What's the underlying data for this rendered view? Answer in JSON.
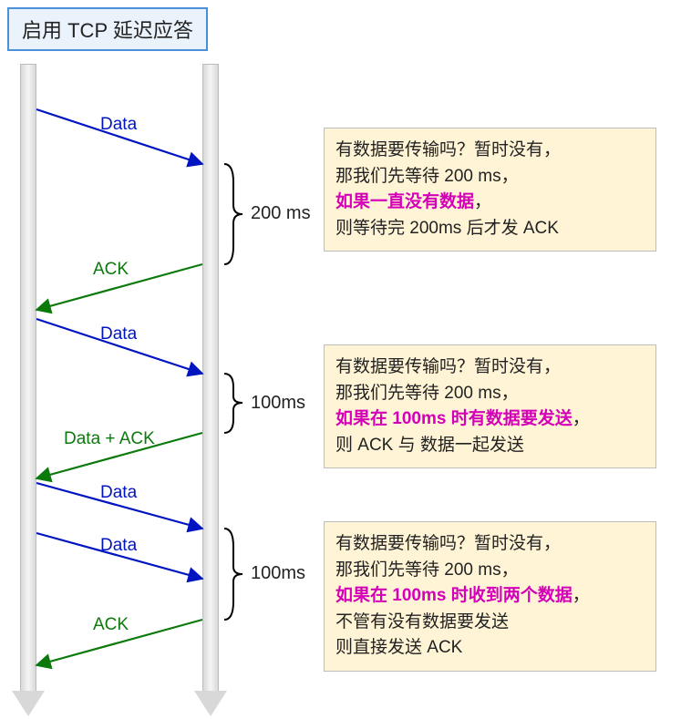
{
  "title": "启用 TCP 延迟应答",
  "arrows": {
    "data1": "Data",
    "ack1": "ACK",
    "data2": "Data",
    "dataack": "Data + ACK",
    "data3": "Data",
    "data4": "Data",
    "ack2": "ACK"
  },
  "braces": {
    "b1": "200 ms",
    "b2": "100ms",
    "b3": "100ms"
  },
  "notes": {
    "n1": {
      "l1": "有数据要传输吗？暂时没有，",
      "l2": "那我们先等待 200 ms，",
      "em": "如果一直没有数据",
      "emsfx": "，",
      "l4": "则等待完 200ms 后才发 ACK"
    },
    "n2": {
      "l1": "有数据要传输吗？暂时没有，",
      "l2": "那我们先等待 200 ms，",
      "em": "如果在 100ms 时有数据要发送",
      "emsfx": "，",
      "l4": "则 ACK 与 数据一起发送"
    },
    "n3": {
      "l1": "有数据要传输吗？暂时没有，",
      "l2": "那我们先等待 200 ms，",
      "em": "如果在 100ms 时收到两个数据",
      "emsfx": "，",
      "l4": "不管有没有数据要发送",
      "l5": "则直接发送 ACK"
    }
  }
}
